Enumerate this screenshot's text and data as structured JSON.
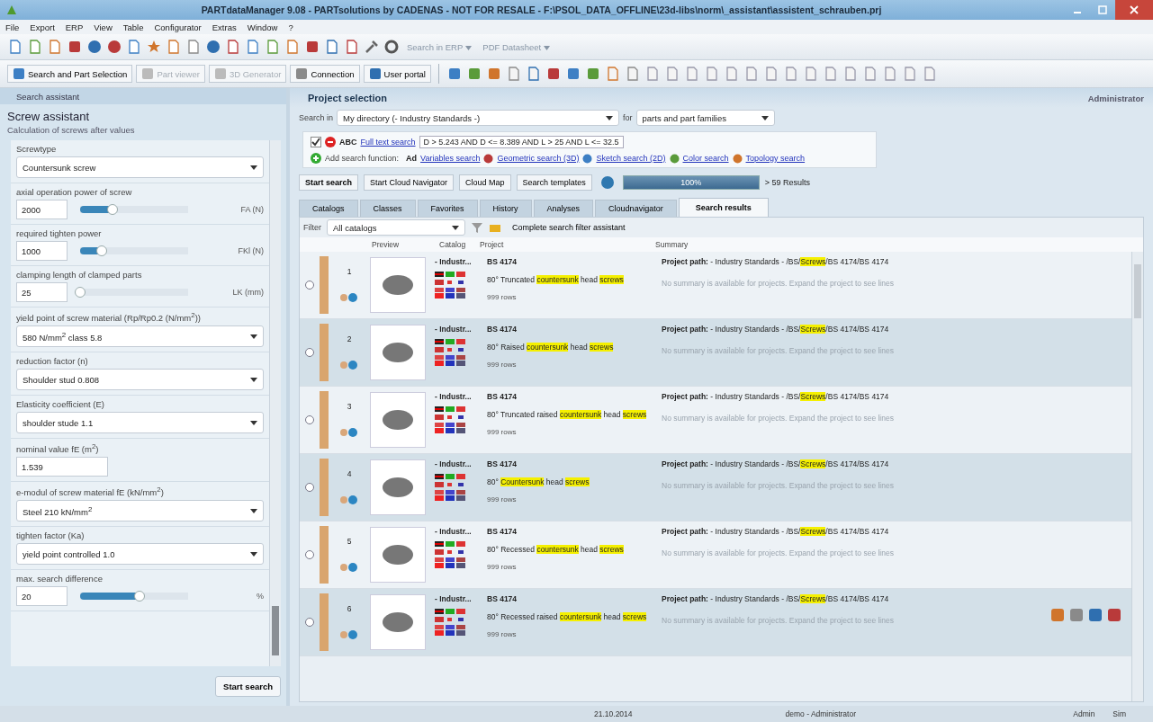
{
  "window": {
    "title": "PARTdataManager 9.08 - PARTsolutions by CADENAS - NOT FOR RESALE - F:\\PSOL_DATA_OFFLINE\\23d-libs\\norm\\_assistant\\assistent_schrauben.prj"
  },
  "menu": [
    "File",
    "Export",
    "ERP",
    "View",
    "Table",
    "Configurator",
    "Extras",
    "Window",
    "?"
  ],
  "toolbar": {
    "dropdowns": [
      "Search in ERP",
      "PDF Datasheet"
    ]
  },
  "modules": [
    {
      "label": "Search and Part Selection",
      "disabled": false
    },
    {
      "label": "Part viewer",
      "disabled": true
    },
    {
      "label": "3D Generator",
      "disabled": true
    },
    {
      "label": "Connection",
      "disabled": false
    },
    {
      "label": "User portal",
      "disabled": false
    }
  ],
  "assistant": {
    "panel_title": "Search assistant",
    "title": "Screw assistant",
    "subtitle": "Calculation of screws after values",
    "start_button": "Start search",
    "fields": [
      {
        "kind": "select",
        "label": "Screwtype",
        "value": "Countersunk screw"
      },
      {
        "kind": "slider",
        "label": "axial operation power of screw",
        "value": "2000",
        "level": 0.3,
        "unit": "FA (N)"
      },
      {
        "kind": "slider",
        "label": "required tighten power",
        "value": "1000",
        "level": 0.2,
        "unit": "FKl (N)"
      },
      {
        "kind": "slider",
        "label": "clamping length of clamped parts",
        "value": "25",
        "level": 0,
        "unit": "LK (mm)"
      },
      {
        "kind": "select",
        "label": "yield point of screw material (Rp/Rp0.2 (N/mm$^{2}$))",
        "value": "580 N/mm$^{2}$ class 5.8"
      },
      {
        "kind": "select",
        "label": "reduction factor (n)",
        "value": "Shoulder stud 0.808"
      },
      {
        "kind": "select",
        "label": "Elasticity coefficient (E)",
        "value": "shoulder stude 1.1"
      },
      {
        "kind": "input",
        "label": "nominal value fE (m$^{2}$)",
        "value": "1.539"
      },
      {
        "kind": "select",
        "label": "e-modul of screw material fE (kN/mm$^{2}$)",
        "value": "Steel 210 kN/mm$^{2}$"
      },
      {
        "kind": "select",
        "label": "tighten factor (Ka)",
        "value": "yield point controlled 1.0"
      },
      {
        "kind": "slider",
        "label": "max. search difference",
        "value": "20",
        "level": 0.55,
        "unit": "%"
      }
    ]
  },
  "project": {
    "title": "Project selection",
    "user": "Administrator",
    "search_in_label": "Search in",
    "search_in": "My directory (- Industry Standards -)",
    "for_label": "for",
    "for": "parts and part families",
    "fulltext": {
      "checked": true,
      "abc": "ABC",
      "link": "Full text search",
      "query": "D > 5.243 AND D <= 8.389 AND L > 25 AND L <= 32.5"
    },
    "add_label": "Add search function:",
    "add_prefix": "Ad",
    "functions": [
      "Variables search",
      "Geometric search (3D)",
      "Sketch search (2D)",
      "Color search",
      "Topology search"
    ],
    "buttons": [
      "Start search",
      "Start Cloud Navigator",
      "Cloud Map",
      "Search templates"
    ],
    "progress": {
      "level": 1,
      "text": "100%"
    },
    "results": "> 59 Results",
    "tabs": [
      {
        "label": "Catalogs",
        "selected": false
      },
      {
        "label": "Classes",
        "selected": false
      },
      {
        "label": "Favorites",
        "selected": false
      },
      {
        "label": "History",
        "selected": false
      },
      {
        "label": "Analyses",
        "selected": false
      },
      {
        "label": "Cloudnavigator",
        "selected": false
      },
      {
        "label": "Search results",
        "selected": true
      }
    ],
    "filter_label": "Filter",
    "filter": "All catalogs",
    "filter_assistant": "Complete search filter assistant",
    "columns": [
      "Preview",
      "Catalog",
      "Project",
      "Summary"
    ],
    "rows": [
      {
        "selected": false,
        "number": "1",
        "catalog": "- Industr...",
        "project": "BS 4174",
        "description": [
          {
            "text": "80° Truncated ",
            "highlight": false
          },
          {
            "text": "countersunk",
            "highlight": true
          },
          {
            "text": " head ",
            "highlight": false
          },
          {
            "text": "screws",
            "highlight": true
          }
        ],
        "lines": "999 rows",
        "path_label": "Project path:",
        "path": [
          {
            "text": "- Industry Standards - /BS/",
            "highlight": false
          },
          {
            "text": "Screws",
            "highlight": true
          },
          {
            "text": "/BS 4174/BS 4174",
            "highlight": false
          }
        ],
        "summary": "No summary is available for projects. Expand the project to see lines",
        "actions": false
      },
      {
        "selected": false,
        "number": "2",
        "catalog": "- Industr...",
        "project": "BS 4174",
        "description": [
          {
            "text": "80° Raised ",
            "highlight": false
          },
          {
            "text": "countersunk",
            "highlight": true
          },
          {
            "text": " head ",
            "highlight": false
          },
          {
            "text": "screws",
            "highlight": true
          }
        ],
        "lines": "999 rows",
        "path_label": "Project path:",
        "path": [
          {
            "text": "- Industry Standards - /BS/",
            "highlight": false
          },
          {
            "text": "Screws",
            "highlight": true
          },
          {
            "text": "/BS 4174/BS 4174",
            "highlight": false
          }
        ],
        "summary": "No summary is available for projects. Expand the project to see lines",
        "actions": false
      },
      {
        "selected": false,
        "number": "3",
        "catalog": "- Industr...",
        "project": "BS 4174",
        "description": [
          {
            "text": "80° Truncated raised ",
            "highlight": false
          },
          {
            "text": "countersunk",
            "highlight": true
          },
          {
            "text": " head ",
            "highlight": false
          },
          {
            "text": "screws",
            "highlight": true
          }
        ],
        "lines": "999 rows",
        "path_label": "Project path:",
        "path": [
          {
            "text": "- Industry Standards - /BS/",
            "highlight": false
          },
          {
            "text": "Screws",
            "highlight": true
          },
          {
            "text": "/BS 4174/BS 4174",
            "highlight": false
          }
        ],
        "summary": "No summary is available for projects. Expand the project to see lines",
        "actions": false
      },
      {
        "selected": false,
        "number": "4",
        "catalog": "- Industr...",
        "project": "BS 4174",
        "description": [
          {
            "text": "80° ",
            "highlight": false
          },
          {
            "text": "Countersunk",
            "highlight": true
          },
          {
            "text": " head ",
            "highlight": false
          },
          {
            "text": "screws",
            "highlight": true
          }
        ],
        "lines": "999 rows",
        "path_label": "Project path:",
        "path": [
          {
            "text": "- Industry Standards - /BS/",
            "highlight": false
          },
          {
            "text": "Screws",
            "highlight": true
          },
          {
            "text": "/BS 4174/BS 4174",
            "highlight": false
          }
        ],
        "summary": "No summary is available for projects. Expand the project to see lines",
        "actions": false
      },
      {
        "selected": false,
        "number": "5",
        "catalog": "- Industr...",
        "project": "BS 4174",
        "description": [
          {
            "text": "80° Recessed ",
            "highlight": false
          },
          {
            "text": "countersunk",
            "highlight": true
          },
          {
            "text": " head ",
            "highlight": false
          },
          {
            "text": "screws",
            "highlight": true
          }
        ],
        "lines": "999 rows",
        "path_label": "Project path:",
        "path": [
          {
            "text": "- Industry Standards - /BS/",
            "highlight": false
          },
          {
            "text": "Screws",
            "highlight": true
          },
          {
            "text": "/BS 4174/BS 4174",
            "highlight": false
          }
        ],
        "summary": "No summary is available for projects. Expand the project to see lines",
        "actions": false
      },
      {
        "selected": false,
        "number": "6",
        "catalog": "- Industr...",
        "project": "BS 4174",
        "description": [
          {
            "text": "80° Recessed raised ",
            "highlight": false
          },
          {
            "text": "countersunk",
            "highlight": true
          },
          {
            "text": " head ",
            "highlight": false
          },
          {
            "text": "screws",
            "highlight": true
          }
        ],
        "lines": "999 rows",
        "path_label": "Project path:",
        "path": [
          {
            "text": "- Industry Standards - /BS/",
            "highlight": false
          },
          {
            "text": "Screws",
            "highlight": true
          },
          {
            "text": "/BS 4174/BS 4174",
            "highlight": false
          }
        ],
        "summary": "No summary is available for projects. Expand the project to see lines",
        "actions": true
      }
    ]
  },
  "status_bar": {
    "date": "21.10.2014",
    "user": "demo - Administrator",
    "role": "Admin",
    "mode": "Sim"
  }
}
